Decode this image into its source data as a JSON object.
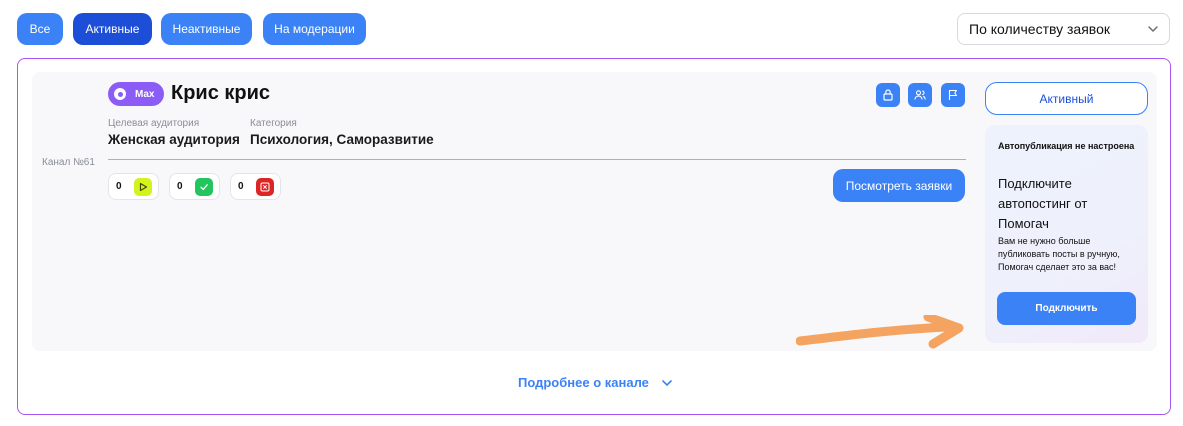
{
  "filters": [
    {
      "label": "Все",
      "active": false
    },
    {
      "label": "Активные",
      "active": true
    },
    {
      "label": "Неактивные",
      "active": false
    },
    {
      "label": "На модерации",
      "active": false
    }
  ],
  "sort": {
    "value": "По количеству заявок",
    "icon": "chevron-down-icon"
  },
  "channel": {
    "number_label": "Канал №61",
    "platform_badge": "Max",
    "title": "Крис крис",
    "audience_label": "Целевая аудитория",
    "audience_value": "Женская аудитория",
    "category_label": "Категория",
    "category_value": "Психология, Саморазвитие",
    "counters": [
      {
        "value": "0",
        "icon": "play-icon",
        "color": "#d4f21f"
      },
      {
        "value": "0",
        "icon": "check-icon",
        "color": "#22c55e"
      },
      {
        "value": "0",
        "icon": "close-icon",
        "color": "#dc2626"
      }
    ],
    "view_requests": "Посмотреть заявки",
    "action_icons": [
      "lock-icon",
      "users-icon",
      "flag-icon"
    ],
    "status": "Активный"
  },
  "promo": {
    "heading": "Автопубликация не настроена",
    "title": "Подключите автопостинг от Помогач",
    "text": "Вам не нужно больше публиковать посты в ручную, Помогач сделает это за вас!",
    "button": "Подключить"
  },
  "details_link": "Подробнее о канале",
  "colors": {
    "accent": "#3b82f6",
    "accent_dark": "#1d4ed8",
    "purple": "#a855f7",
    "annotation_arrow": "#f4a460"
  }
}
